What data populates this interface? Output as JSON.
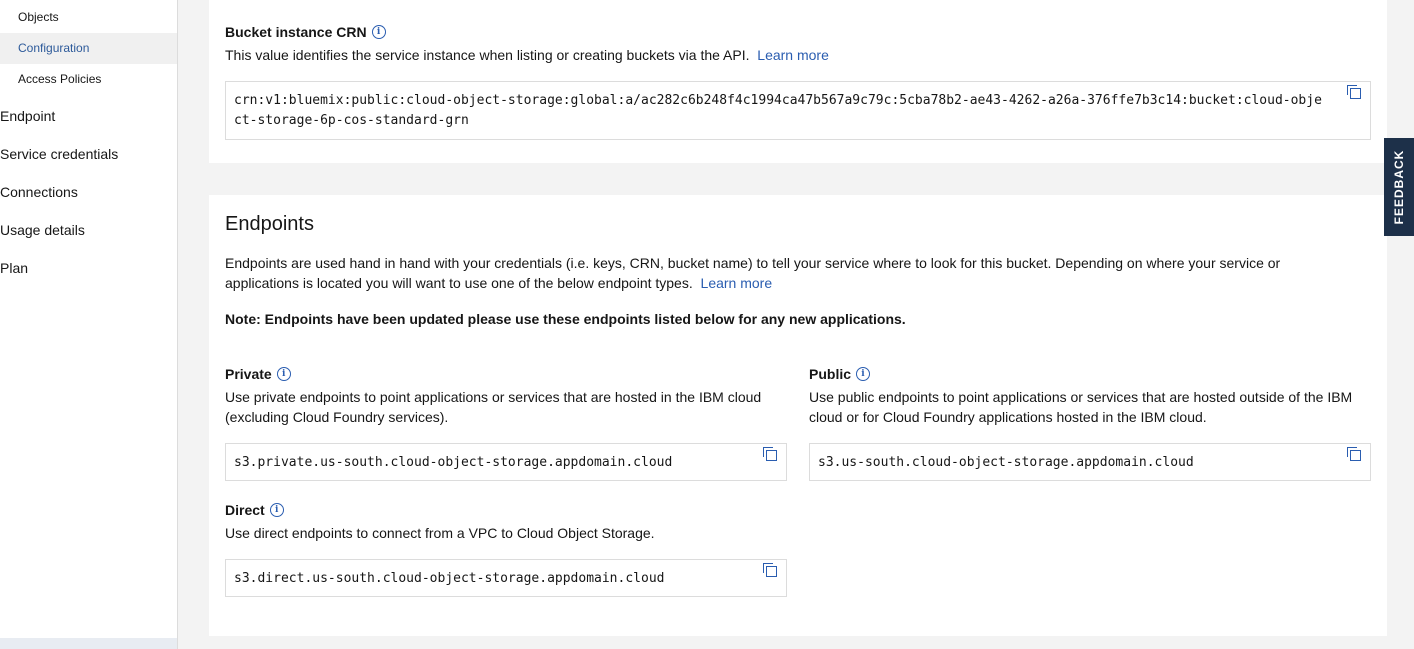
{
  "sidebar": {
    "sub_items": [
      {
        "label": "Objects",
        "active": false
      },
      {
        "label": "Configuration",
        "active": true
      },
      {
        "label": "Access Policies",
        "active": false
      }
    ],
    "nav_items": [
      {
        "label": "Endpoint"
      },
      {
        "label": "Service credentials"
      },
      {
        "label": "Connections"
      },
      {
        "label": "Usage details"
      },
      {
        "label": "Plan"
      }
    ]
  },
  "crn": {
    "title": "Bucket instance CRN",
    "description": "This value identifies the service instance when listing or creating buckets via the API.",
    "learn_more": "Learn more",
    "value": "crn:v1:bluemix:public:cloud-object-storage:global:a/ac282c6b248f4c1994ca47b567a9c79c:5cba78b2-ae43-4262-a26a-376ffe7b3c14:bucket:cloud-object-storage-6p-cos-standard-grn"
  },
  "endpoints": {
    "title": "Endpoints",
    "description": "Endpoints are used hand in hand with your credentials (i.e. keys, CRN, bucket name) to tell your service where to look for this bucket. Depending on where your service or applications is located you will want to use one of the below endpoint types.",
    "learn_more": "Learn more",
    "note": "Note: Endpoints have been updated please use these endpoints listed below for any new applications.",
    "private": {
      "title": "Private",
      "description": "Use private endpoints to point applications or services that are hosted in the IBM cloud (excluding Cloud Foundry services).",
      "value": "s3.private.us-south.cloud-object-storage.appdomain.cloud"
    },
    "public": {
      "title": "Public",
      "description": "Use public endpoints to point applications or services that are hosted outside of the IBM cloud or for Cloud Foundry applications hosted in the IBM cloud.",
      "value": "s3.us-south.cloud-object-storage.appdomain.cloud"
    },
    "direct": {
      "title": "Direct",
      "description": "Use direct endpoints to connect from a VPC to Cloud Object Storage.",
      "value": "s3.direct.us-south.cloud-object-storage.appdomain.cloud"
    }
  },
  "feedback": {
    "label": "FEEDBACK"
  },
  "colors": {
    "link": "#2a5db0",
    "feedback_bg": "#1d3049"
  }
}
